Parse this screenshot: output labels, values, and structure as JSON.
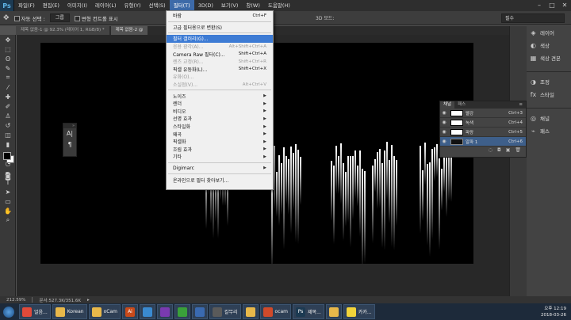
{
  "menubar": {
    "logo": "Ps",
    "items": [
      "파일(F)",
      "편집(E)",
      "이미지(I)",
      "레이어(L)",
      "유형(Y)",
      "선택(S)",
      "필터(T)",
      "3D(D)",
      "보기(V)",
      "창(W)",
      "도움말(H)"
    ],
    "active_index": 6,
    "window_controls": [
      "–",
      "□",
      "✕"
    ]
  },
  "options": {
    "auto_select_label": "자동 선택 :",
    "auto_select_value": "그룹",
    "transform_label": "변형 컨트롤 표시",
    "mode_3d": "3D 모드:",
    "workspace": "필수"
  },
  "tabs": [
    "제목 없음-1 @ 92.3% (레이어 1, RGB/8) *",
    "제목 없음-2 @"
  ],
  "filter_menu": {
    "items": [
      {
        "label": "바람",
        "shortcut": "Ctrl+F",
        "disabled": false
      },
      {
        "sep": true
      },
      {
        "label": "고급 필터용으로 변환(S)",
        "shortcut": "",
        "disabled": false
      },
      {
        "sep": true
      },
      {
        "label": "필터 갤러리(G)...",
        "shortcut": "",
        "disabled": false,
        "highlight": true
      },
      {
        "label": "응용 광각(A)...",
        "shortcut": "Alt+Shift+Ctrl+A",
        "disabled": true
      },
      {
        "label": "Camera Raw 필터(C)...",
        "shortcut": "Shift+Ctrl+A",
        "disabled": false
      },
      {
        "label": "렌즈 교정(R)...",
        "shortcut": "Shift+Ctrl+R",
        "disabled": true
      },
      {
        "label": "픽셀 유동화(L)...",
        "shortcut": "Shift+Ctrl+X",
        "disabled": false
      },
      {
        "label": "유화(O)...",
        "shortcut": "",
        "disabled": true
      },
      {
        "label": "소실점(V)...",
        "shortcut": "Alt+Ctrl+V",
        "disabled": true
      },
      {
        "sep": true
      },
      {
        "label": "노이즈",
        "submenu": true
      },
      {
        "label": "렌더",
        "submenu": true
      },
      {
        "label": "비디오",
        "submenu": true
      },
      {
        "label": "선명 효과",
        "submenu": true
      },
      {
        "label": "스타일화",
        "submenu": true
      },
      {
        "label": "왜곡",
        "submenu": true
      },
      {
        "label": "픽셀화",
        "submenu": true
      },
      {
        "label": "흐림 효과",
        "submenu": true
      },
      {
        "label": "기타",
        "submenu": true
      },
      {
        "sep": true
      },
      {
        "label": "Digimarc",
        "submenu": true
      },
      {
        "sep": true
      },
      {
        "label": "온라인으로 필터 찾아보기...",
        "shortcut": ""
      }
    ]
  },
  "right_panel": {
    "items": [
      {
        "icon": "layers-icon",
        "glyph": "◈",
        "label": "레이어"
      },
      {
        "icon": "color-icon",
        "glyph": "◐",
        "label": "색상"
      },
      {
        "icon": "swatches-icon",
        "glyph": "▦",
        "label": "색상 견본"
      },
      {
        "icon": "adjustments-icon",
        "glyph": "◑",
        "label": "조정"
      },
      {
        "icon": "styles-icon",
        "glyph": "fx",
        "label": "스타일"
      },
      {
        "icon": "channels-icon",
        "glyph": "◎",
        "label": "채널"
      },
      {
        "icon": "paths-icon",
        "glyph": "⌁",
        "label": "패스"
      }
    ]
  },
  "channels_panel": {
    "tabs": [
      "채널",
      "패스"
    ],
    "rows": [
      {
        "name": "빨강",
        "key": "Ctrl+3",
        "dark": false,
        "selected": false
      },
      {
        "name": "녹색",
        "key": "Ctrl+4",
        "dark": false,
        "selected": false
      },
      {
        "name": "파랑",
        "key": "Ctrl+5",
        "dark": false,
        "selected": false
      },
      {
        "name": "알파 1",
        "key": "Ctrl+6",
        "dark": true,
        "selected": true
      }
    ]
  },
  "char_panel": {
    "a": "A|",
    "b": "¶"
  },
  "status": {
    "zoom": "212.59%",
    "doc": "문서:527.3K/351.6K"
  },
  "taskbar": {
    "buttons": [
      {
        "label": "얼음...",
        "color": "#e04a3a"
      },
      {
        "label": "Korean",
        "color": "#e8b84a"
      },
      {
        "label": "oCam",
        "color": "#e8b84a"
      },
      {
        "label": "",
        "color": "#c84a1a",
        "text": "Ai"
      },
      {
        "label": "",
        "color": "#3a8ad0"
      },
      {
        "label": "",
        "color": "#7a3ab0"
      },
      {
        "label": "",
        "color": "#3aa03a"
      },
      {
        "label": "",
        "color": "#3a6ab0"
      },
      {
        "label": "칼무리",
        "color": "#5a5a5a"
      },
      {
        "label": "",
        "color": "#e8b84a"
      },
      {
        "label": "ocam",
        "color": "#d04a2a"
      },
      {
        "label": "제목...",
        "color": "#1c3a52",
        "text": "Ps"
      },
      {
        "label": "",
        "color": "#e8b84a"
      },
      {
        "label": "카카...",
        "color": "#f2d43a"
      }
    ],
    "time": "오후 12:19",
    "date": "2018-03-26"
  }
}
